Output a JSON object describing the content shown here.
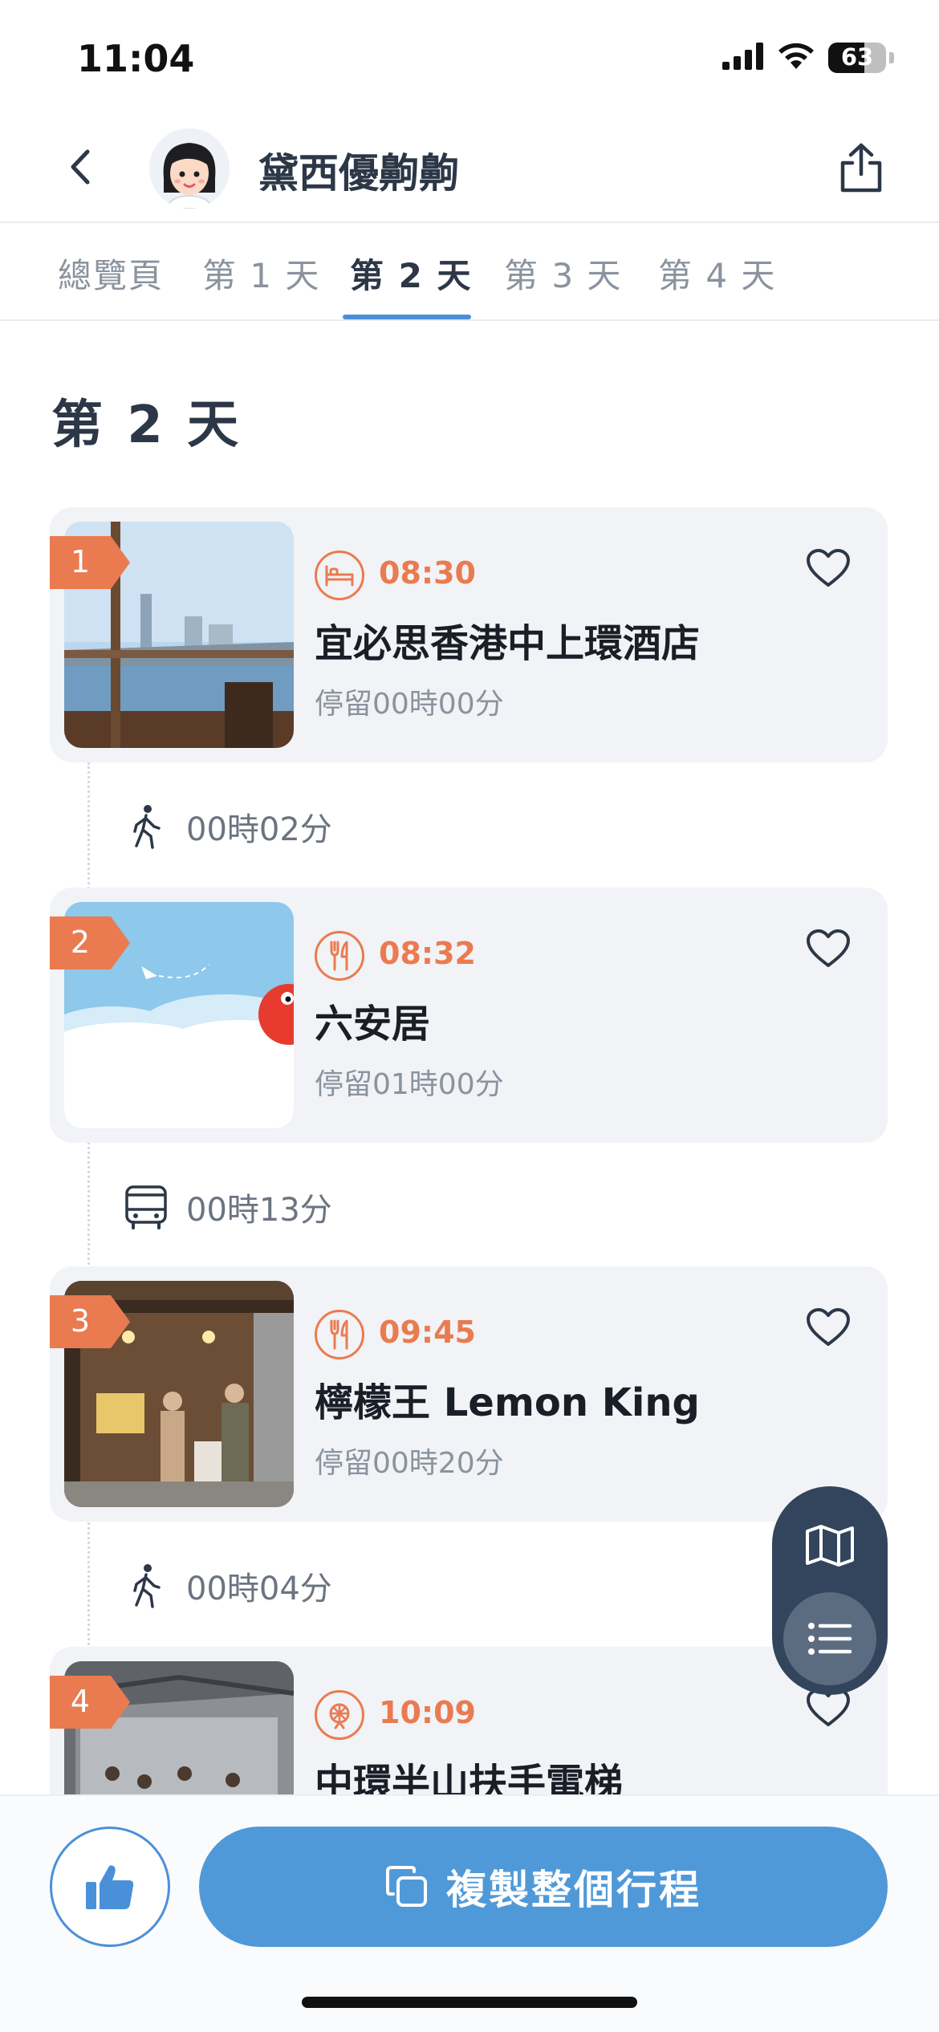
{
  "status_bar": {
    "time": "11:04",
    "battery_level": "63",
    "battery_fraction": 0.63
  },
  "header": {
    "title": "黛西優齁齁"
  },
  "tabs": [
    {
      "label": "總覽頁",
      "active": false
    },
    {
      "label": "第 1 天",
      "active": false
    },
    {
      "label": "第 2 天",
      "active": true
    },
    {
      "label": "第 3 天",
      "active": false
    },
    {
      "label": "第 4 天",
      "active": false
    }
  ],
  "day_title": "第 2 天",
  "stops": [
    {
      "order": "1",
      "category_icon": "hotel-icon",
      "time": "08:30",
      "name": "宜必思香港中上環酒店",
      "stay": "停留00時00分"
    },
    {
      "order": "2",
      "category_icon": "restaurant-icon",
      "time": "08:32",
      "name": "六安居",
      "stay": "停留01時00分"
    },
    {
      "order": "3",
      "category_icon": "restaurant-icon",
      "time": "09:45",
      "name": "檸檬王 Lemon King",
      "stay": "停留00時20分"
    },
    {
      "order": "4",
      "category_icon": "attraction-icon",
      "time": "10:09",
      "name": "中環半山扶手電梯",
      "stay": ""
    }
  ],
  "transits": [
    {
      "mode_icon": "walking-icon",
      "duration": "00時02分"
    },
    {
      "mode_icon": "bus-icon",
      "duration": "00時13分"
    },
    {
      "mode_icon": "walking-icon",
      "duration": "00時04分"
    }
  ],
  "bottom_bar": {
    "copy_label": "複製整個行程"
  },
  "colors": {
    "accent": "#ea7b50",
    "primary": "#5099d8",
    "fab": "#33455c"
  }
}
